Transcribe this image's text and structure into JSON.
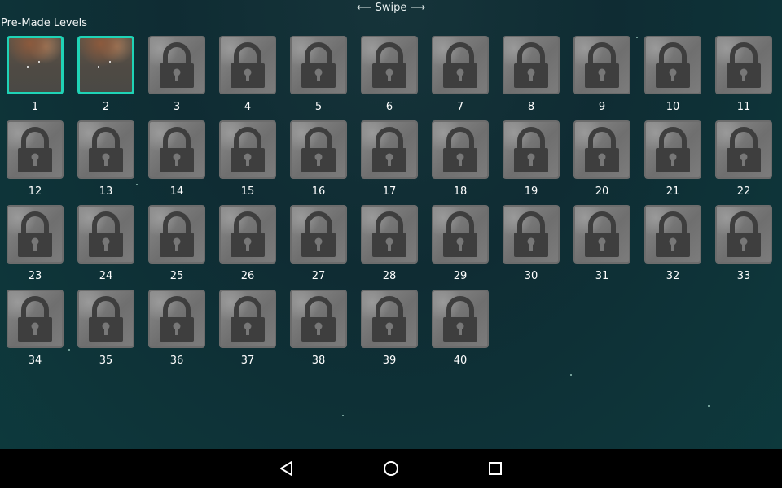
{
  "header": {
    "swipe_hint": "⟵ Swipe ⟶",
    "section_title": "Pre-Made Levels"
  },
  "levels": [
    {
      "label": "1",
      "locked": false
    },
    {
      "label": "2",
      "locked": false
    },
    {
      "label": "3",
      "locked": true
    },
    {
      "label": "4",
      "locked": true
    },
    {
      "label": "5",
      "locked": true
    },
    {
      "label": "6",
      "locked": true
    },
    {
      "label": "7",
      "locked": true
    },
    {
      "label": "8",
      "locked": true
    },
    {
      "label": "9",
      "locked": true
    },
    {
      "label": "10",
      "locked": true
    },
    {
      "label": "11",
      "locked": true
    },
    {
      "label": "12",
      "locked": true
    },
    {
      "label": "13",
      "locked": true
    },
    {
      "label": "14",
      "locked": true
    },
    {
      "label": "15",
      "locked": true
    },
    {
      "label": "16",
      "locked": true
    },
    {
      "label": "17",
      "locked": true
    },
    {
      "label": "18",
      "locked": true
    },
    {
      "label": "19",
      "locked": true
    },
    {
      "label": "20",
      "locked": true
    },
    {
      "label": "21",
      "locked": true
    },
    {
      "label": "22",
      "locked": true
    },
    {
      "label": "23",
      "locked": true
    },
    {
      "label": "24",
      "locked": true
    },
    {
      "label": "25",
      "locked": true
    },
    {
      "label": "26",
      "locked": true
    },
    {
      "label": "27",
      "locked": true
    },
    {
      "label": "28",
      "locked": true
    },
    {
      "label": "29",
      "locked": true
    },
    {
      "label": "30",
      "locked": true
    },
    {
      "label": "31",
      "locked": true
    },
    {
      "label": "32",
      "locked": true
    },
    {
      "label": "33",
      "locked": true
    },
    {
      "label": "34",
      "locked": true
    },
    {
      "label": "35",
      "locked": true
    },
    {
      "label": "36",
      "locked": true
    },
    {
      "label": "37",
      "locked": true
    },
    {
      "label": "38",
      "locked": true
    },
    {
      "label": "39",
      "locked": true
    },
    {
      "label": "40",
      "locked": true
    }
  ],
  "icons": {
    "locked": "lock-icon",
    "nav_back": "back-triangle-icon",
    "nav_home": "home-circle-icon",
    "nav_recents": "recents-square-icon"
  },
  "colors": {
    "unlocked_border": "#1fd3b6",
    "locked_border": "#6c6c6c",
    "navbar": "#000000"
  }
}
